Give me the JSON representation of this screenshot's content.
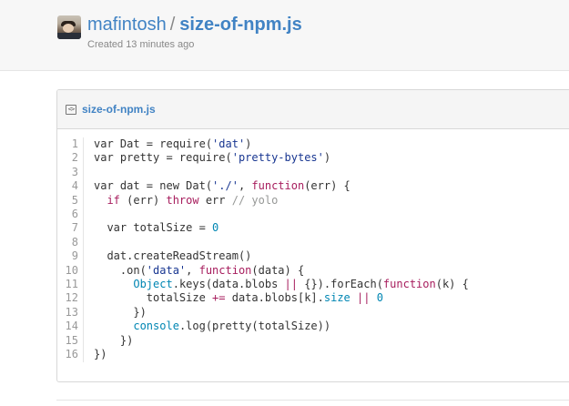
{
  "header": {
    "owner": "mafintosh",
    "separator": "/",
    "repo": "size-of-npm.js",
    "created": "Created 13 minutes ago"
  },
  "file": {
    "name": "size-of-npm.js",
    "icon": "code-file-icon"
  },
  "code": {
    "lines": [
      [
        {
          "t": "var Dat = require("
        },
        {
          "t": "'dat'",
          "c": "s"
        },
        {
          "t": ")"
        }
      ],
      [
        {
          "t": "var pretty = require("
        },
        {
          "t": "'pretty-bytes'",
          "c": "s"
        },
        {
          "t": ")"
        }
      ],
      [
        {
          "t": ""
        }
      ],
      [
        {
          "t": "var dat = new Dat("
        },
        {
          "t": "'./'",
          "c": "s"
        },
        {
          "t": ", "
        },
        {
          "t": "function",
          "c": "k"
        },
        {
          "t": "(err) {"
        }
      ],
      [
        {
          "t": "  "
        },
        {
          "t": "if",
          "c": "k"
        },
        {
          "t": " (err) "
        },
        {
          "t": "throw",
          "c": "k"
        },
        {
          "t": " err "
        },
        {
          "t": "// yolo",
          "c": "c"
        }
      ],
      [
        {
          "t": ""
        }
      ],
      [
        {
          "t": "  var totalSize = "
        },
        {
          "t": "0",
          "c": "n"
        }
      ],
      [
        {
          "t": ""
        }
      ],
      [
        {
          "t": "  dat.createReadStream()"
        }
      ],
      [
        {
          "t": "    .on("
        },
        {
          "t": "'data'",
          "c": "s"
        },
        {
          "t": ", "
        },
        {
          "t": "function",
          "c": "k"
        },
        {
          "t": "(data) {"
        }
      ],
      [
        {
          "t": "      "
        },
        {
          "t": "Object",
          "c": "n"
        },
        {
          "t": ".keys(data.blobs "
        },
        {
          "t": "||",
          "c": "k"
        },
        {
          "t": " {}).forEach("
        },
        {
          "t": "function",
          "c": "k"
        },
        {
          "t": "(k) {"
        }
      ],
      [
        {
          "t": "        totalSize "
        },
        {
          "t": "+=",
          "c": "k"
        },
        {
          "t": " data.blobs[k]."
        },
        {
          "t": "size",
          "c": "n"
        },
        {
          "t": " "
        },
        {
          "t": "||",
          "c": "k"
        },
        {
          "t": " "
        },
        {
          "t": "0",
          "c": "n"
        }
      ],
      [
        {
          "t": "      })"
        }
      ],
      [
        {
          "t": "      "
        },
        {
          "t": "console",
          "c": "n"
        },
        {
          "t": ".log(pretty(totalSize))"
        }
      ],
      [
        {
          "t": "    })"
        }
      ],
      [
        {
          "t": "})"
        }
      ]
    ]
  },
  "colors": {
    "link": "#4183c4",
    "keyword": "#a71d5d",
    "string": "#183691",
    "builtin": "#0086b3",
    "comment": "#969896"
  }
}
